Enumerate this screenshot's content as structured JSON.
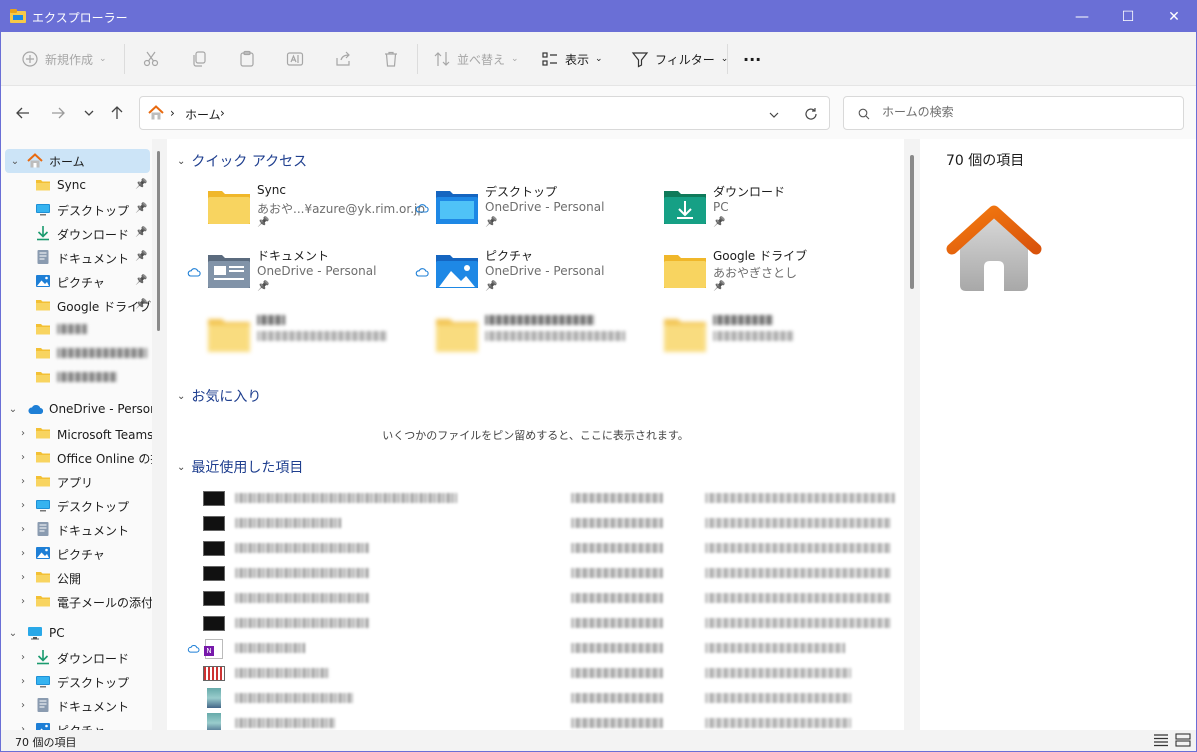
{
  "window": {
    "title": "エクスプローラー",
    "minimize": "—",
    "maximize": "☐",
    "close": "✕"
  },
  "toolbar": {
    "new_label": "新規作成",
    "sort_label": "並べ替え",
    "view_label": "表示",
    "filter_label": "フィルター",
    "more": "···"
  },
  "address": {
    "crumb_home": "ホーム",
    "crumb_sep": "›",
    "search_placeholder": "ホームの検索"
  },
  "sidebar": {
    "home": "ホーム",
    "quick": [
      {
        "label": "Sync",
        "icon": "folder-icon"
      },
      {
        "label": "デスクトップ",
        "icon": "desktop-icon"
      },
      {
        "label": "ダウンロード",
        "icon": "download-icon"
      },
      {
        "label": "ドキュメント",
        "icon": "document-icon"
      },
      {
        "label": "ピクチャ",
        "icon": "picture-icon"
      },
      {
        "label": "Google ドライブ",
        "icon": "folder-icon"
      }
    ],
    "onedrive": "OneDrive - Personal",
    "onedrive_items": [
      {
        "label": "Microsoft Teams チャット ファイル",
        "icon": "folder-icon"
      },
      {
        "label": "Office Online の拡張機能",
        "icon": "folder-icon"
      },
      {
        "label": "アプリ",
        "icon": "folder-icon"
      },
      {
        "label": "デスクトップ",
        "icon": "desktop-icon"
      },
      {
        "label": "ドキュメント",
        "icon": "document-icon"
      },
      {
        "label": "ピクチャ",
        "icon": "picture-icon"
      },
      {
        "label": "公開",
        "icon": "folder-icon"
      },
      {
        "label": "電子メールの添付ファイル",
        "icon": "folder-icon"
      }
    ],
    "pc": "PC",
    "pc_items": [
      {
        "label": "ダウンロード",
        "icon": "download-icon"
      },
      {
        "label": "デスクトップ",
        "icon": "desktop-icon"
      },
      {
        "label": "ドキュメント",
        "icon": "document-icon"
      },
      {
        "label": "ピクチャ",
        "icon": "picture-icon"
      }
    ]
  },
  "content": {
    "quick_access_header": "クイック アクセス",
    "quick_access": [
      {
        "name": "Sync",
        "sub": "あおや...¥azure@yk.rim.or.jp",
        "icon": "folder-icon"
      },
      {
        "name": "デスクトップ",
        "sub": "OneDrive - Personal",
        "icon": "desktop-icon"
      },
      {
        "name": "ダウンロード",
        "sub": "PC",
        "icon": "download-icon"
      },
      {
        "name": "ドキュメント",
        "sub": "OneDrive - Personal",
        "icon": "document-icon"
      },
      {
        "name": "ピクチャ",
        "sub": "OneDrive - Personal",
        "icon": "picture-icon"
      },
      {
        "name": "Google ドライブ",
        "sub": "あおやぎさとし",
        "icon": "folder-icon"
      }
    ],
    "favorites_header": "お気に入り",
    "favorites_empty": "いくつかのファイルをピン留めすると、ここに表示されます。",
    "recent_header": "最近使用した項目"
  },
  "details": {
    "count": "70 個の項目"
  },
  "status": {
    "count": "70 個の項目"
  },
  "colors": {
    "titlebar": "#6a6fd6",
    "accent": "#1f3f8f",
    "selection": "#cce4f7",
    "folder": "#f8d460"
  }
}
